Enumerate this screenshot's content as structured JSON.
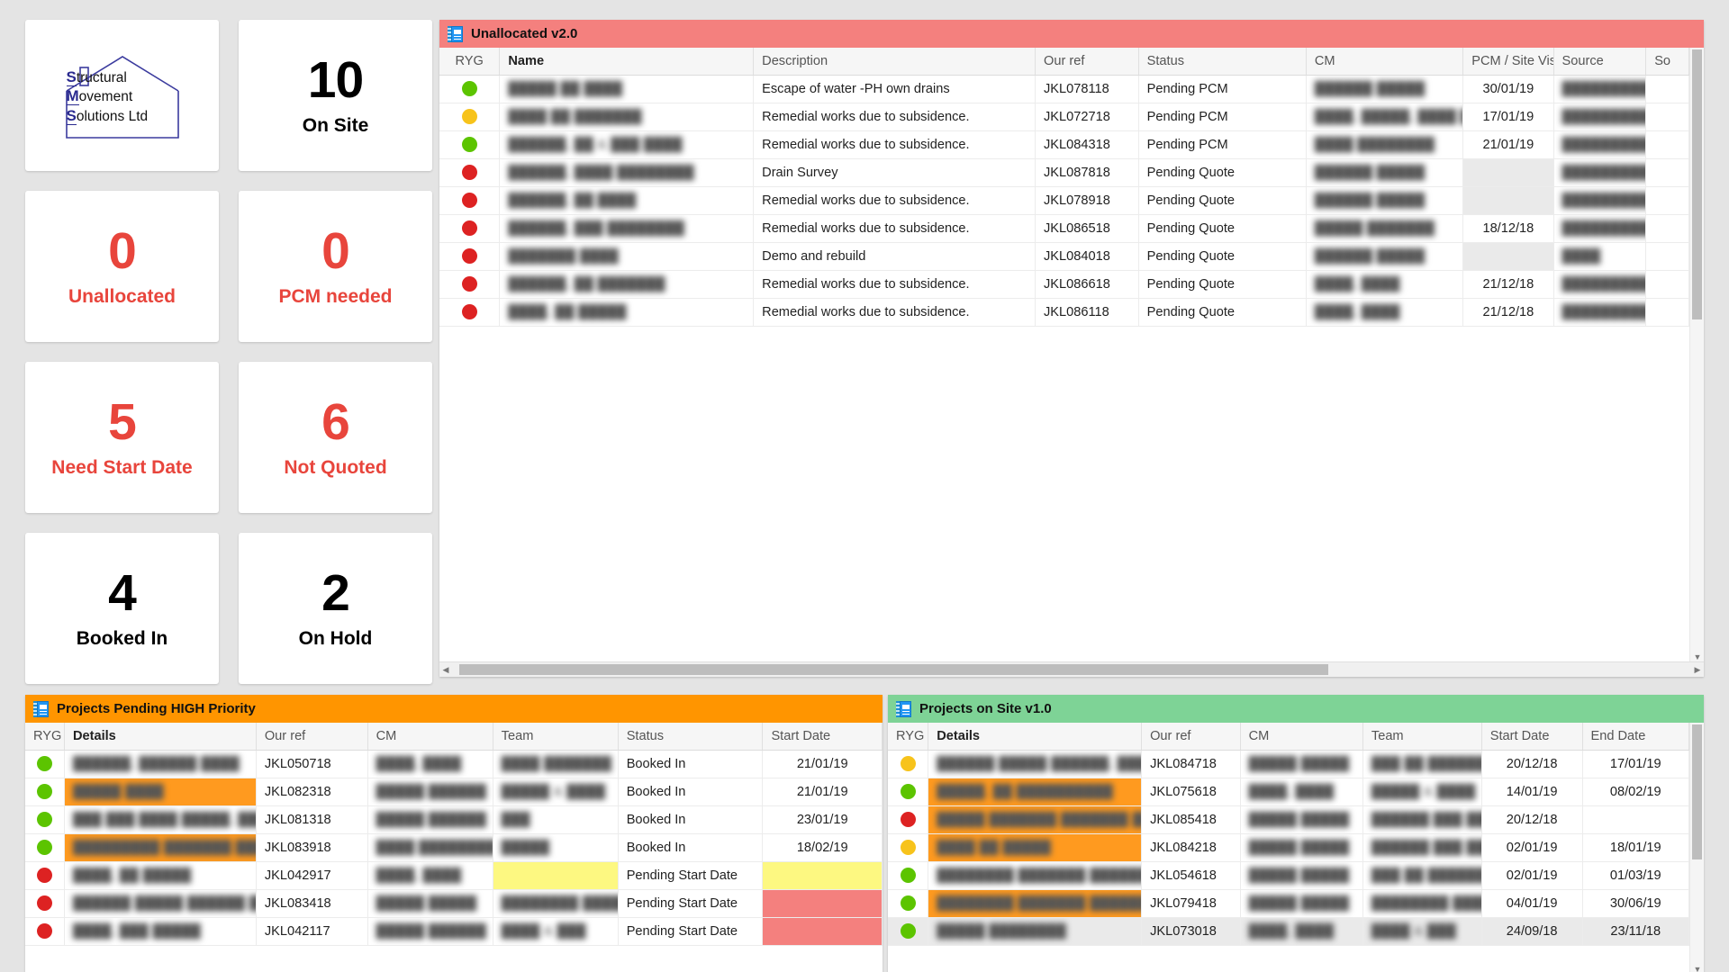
{
  "logo": {
    "lines": [
      {
        "cap": "S",
        "rest": "tructural"
      },
      {
        "cap": "M",
        "rest": "ovement"
      },
      {
        "cap": "S",
        "rest": "olutions Ltd"
      }
    ]
  },
  "kpis": [
    {
      "value": "10",
      "label": "On Site",
      "style": "black"
    },
    {
      "value": "0",
      "label": "Unallocated",
      "style": "red"
    },
    {
      "value": "0",
      "label": "PCM needed",
      "style": "red"
    },
    {
      "value": "5",
      "label": "Need Start Date",
      "style": "red"
    },
    {
      "value": "6",
      "label": "Not Quoted",
      "style": "red"
    },
    {
      "value": "4",
      "label": "Booked In",
      "style": "black"
    },
    {
      "value": "2",
      "label": "On Hold",
      "style": "black"
    }
  ],
  "colors": {
    "unallocated_header": "#f4807e",
    "high_priority_header": "#ff9500",
    "on_site_header": "#7ed396",
    "kpi_red": "#e8453c",
    "ryg_green": "#5cc400",
    "ryg_amber": "#f7c31b",
    "ryg_red": "#dd2222",
    "highlight_orange": "#ff9a1f",
    "highlight_yellow": "#fdf881",
    "highlight_pink": "#f4807e"
  },
  "unallocated": {
    "title": "Unallocated v2.0",
    "icon": "report-icon",
    "columns": [
      "RYG",
      "Name",
      "Description",
      "Our ref",
      "Status",
      "CM",
      "PCM / Site Visit",
      "Source",
      "So"
    ],
    "rows": [
      {
        "ryg": "green",
        "name": "█████  ██ ████",
        "description": "Escape of water -PH own drains",
        "our_ref": "JKL078118",
        "status": "Pending PCM",
        "cm": "██████ █████",
        "pcm_visit": "30/01/19",
        "source": "██████████",
        "source2": ""
      },
      {
        "ryg": "amber",
        "name": "████  ██ ███████",
        "description": "Remedial works due to subsidence.",
        "our_ref": "JKL072718",
        "status": "Pending PCM",
        "cm": "████, █████, ████ ██",
        "pcm_visit": "17/01/19",
        "source": "██████████",
        "source2": ""
      },
      {
        "ryg": "green",
        "name": "██████, ██ & ███ ████",
        "description": "Remedial works due to subsidence.",
        "our_ref": "JKL084318",
        "status": "Pending PCM",
        "cm": "████ ████████",
        "pcm_visit": "21/01/19",
        "source": "██████████",
        "source2": ""
      },
      {
        "ryg": "red",
        "name": "██████, ████ ████████",
        "description": "Drain Survey",
        "our_ref": "JKL087818",
        "status": "Pending Quote",
        "cm": "██████ █████",
        "pcm_visit": "",
        "source": "██████████",
        "source2": ""
      },
      {
        "ryg": "red",
        "name": "██████, ██ ████",
        "description": "Remedial works due to subsidence.",
        "our_ref": "JKL078918",
        "status": "Pending Quote",
        "cm": "██████ █████",
        "pcm_visit": "",
        "source": "██████████",
        "source2": ""
      },
      {
        "ryg": "red",
        "name": "██████, ███ ████████",
        "description": "Remedial works due to subsidence.",
        "our_ref": "JKL086518",
        "status": "Pending Quote",
        "cm": "█████ ███████",
        "pcm_visit": "18/12/18",
        "source": "██████████",
        "source2": ""
      },
      {
        "ryg": "red",
        "name": "███████ ████",
        "description": "Demo and rebuild",
        "our_ref": "JKL084018",
        "status": "Pending Quote",
        "cm": "██████ █████",
        "pcm_visit": "",
        "source": "████",
        "source2": ""
      },
      {
        "ryg": "red",
        "name": "██████, ██ ███████",
        "description": "Remedial works due to subsidence.",
        "our_ref": "JKL086618",
        "status": "Pending Quote",
        "cm": "████, ████",
        "pcm_visit": "21/12/18",
        "source": "██████████",
        "source2": ""
      },
      {
        "ryg": "red",
        "name": "████, ██ █████",
        "description": "Remedial works due to subsidence.",
        "our_ref": "JKL086118",
        "status": "Pending Quote",
        "cm": "████, ████",
        "pcm_visit": "21/12/18",
        "source": "██████████",
        "source2": ""
      }
    ]
  },
  "high_priority": {
    "title": "Projects Pending HIGH Priority",
    "icon": "report-icon",
    "columns": [
      "RYG",
      "Details",
      "Our ref",
      "CM",
      "Team",
      "Status",
      "Start Date"
    ],
    "rows": [
      {
        "ryg": "green",
        "details": "██████, ██████ ████",
        "details_hl": "none",
        "our_ref": "JKL050718",
        "cm": "████, ████",
        "team": "████ ███████",
        "team_hl": "none",
        "status": "Booked In",
        "start_date": "21/01/19",
        "start_hl": "none"
      },
      {
        "ryg": "green",
        "details": "█████ ████",
        "details_hl": "orange",
        "our_ref": "JKL082318",
        "cm": "█████ ██████",
        "team": "█████ & ████",
        "team_hl": "none",
        "status": "Booked In",
        "start_date": "21/01/19",
        "start_hl": "none"
      },
      {
        "ryg": "green",
        "details": "███ ███ ████ █████, ███",
        "details_hl": "none",
        "our_ref": "JKL081318",
        "cm": "█████ ██████",
        "team": "███",
        "team_hl": "none",
        "status": "Booked In",
        "start_date": "23/01/19",
        "start_hl": "none"
      },
      {
        "ryg": "green",
        "details": "█████████ ███████ ███",
        "details_hl": "orange",
        "our_ref": "JKL083918",
        "cm": "████ ████████",
        "team": "█████",
        "team_hl": "none",
        "status": "Booked In",
        "start_date": "18/02/19",
        "start_hl": "none"
      },
      {
        "ryg": "red",
        "details": "████, ██ █████",
        "details_hl": "none",
        "our_ref": "JKL042917",
        "cm": "████, ████",
        "team": "",
        "team_hl": "yellow",
        "status": "Pending Start Date",
        "start_date": "",
        "start_hl": "yellow"
      },
      {
        "ryg": "red",
        "details": "██████ █████ ██████ ██",
        "details_hl": "none",
        "our_ref": "JKL083418",
        "cm": "█████ █████",
        "team": "████████ █████",
        "team_hl": "none",
        "status": "Pending Start Date",
        "start_date": "",
        "start_hl": "pink"
      },
      {
        "ryg": "red",
        "details": "████, ███ █████",
        "details_hl": "none",
        "our_ref": "JKL042117",
        "cm": "█████ ██████",
        "team": "████ & ███",
        "team_hl": "none",
        "status": "Pending Start Date",
        "start_date": "",
        "start_hl": "pink"
      }
    ]
  },
  "on_site": {
    "title": "Projects on Site v1.0",
    "icon": "report-icon",
    "columns": [
      "RYG",
      "Details",
      "Our ref",
      "CM",
      "Team",
      "Start Date",
      "End Date"
    ],
    "rows": [
      {
        "ryg": "amber",
        "details": "██████ █████ ██████, ████",
        "details_hl": "none",
        "our_ref": "JKL084718",
        "cm": "█████ █████",
        "team": "███ ██ ██████",
        "start_date": "20/12/18",
        "end_date": "17/01/19"
      },
      {
        "ryg": "green",
        "details": "█████, ██ ██████████",
        "details_hl": "orange",
        "our_ref": "JKL075618",
        "cm": "████, ████",
        "team": "█████ & ████",
        "start_date": "14/01/19",
        "end_date": "08/02/19"
      },
      {
        "ryg": "red",
        "details": "█████ ███████ ███████ █████",
        "details_hl": "orange",
        "our_ref": "JKL085418",
        "cm": "█████ █████",
        "team": "██████ ███ ███",
        "start_date": "20/12/18",
        "end_date": ""
      },
      {
        "ryg": "amber",
        "details": "████ ██ █████",
        "details_hl": "orange",
        "our_ref": "JKL084218",
        "cm": "█████ █████",
        "team": "██████ ███ █████",
        "start_date": "02/01/19",
        "end_date": "18/01/19"
      },
      {
        "ryg": "green",
        "details": "████████ ███████ ██████",
        "details_hl": "none",
        "our_ref": "JKL054618",
        "cm": "█████ █████",
        "team": "███ ██ ██████",
        "start_date": "02/01/19",
        "end_date": "01/03/19"
      },
      {
        "ryg": "green",
        "details": "████████ ███████ ██████",
        "details_hl": "orange",
        "our_ref": "JKL079418",
        "cm": "█████ █████",
        "team": "████████ █████",
        "start_date": "04/01/19",
        "end_date": "30/06/19"
      },
      {
        "ryg": "green",
        "details": "█████ ████████",
        "details_hl": "none",
        "our_ref": "JKL073018",
        "cm": "████, ████",
        "team": "████ & ███",
        "start_date": "24/09/18",
        "end_date": "23/11/18"
      }
    ]
  }
}
